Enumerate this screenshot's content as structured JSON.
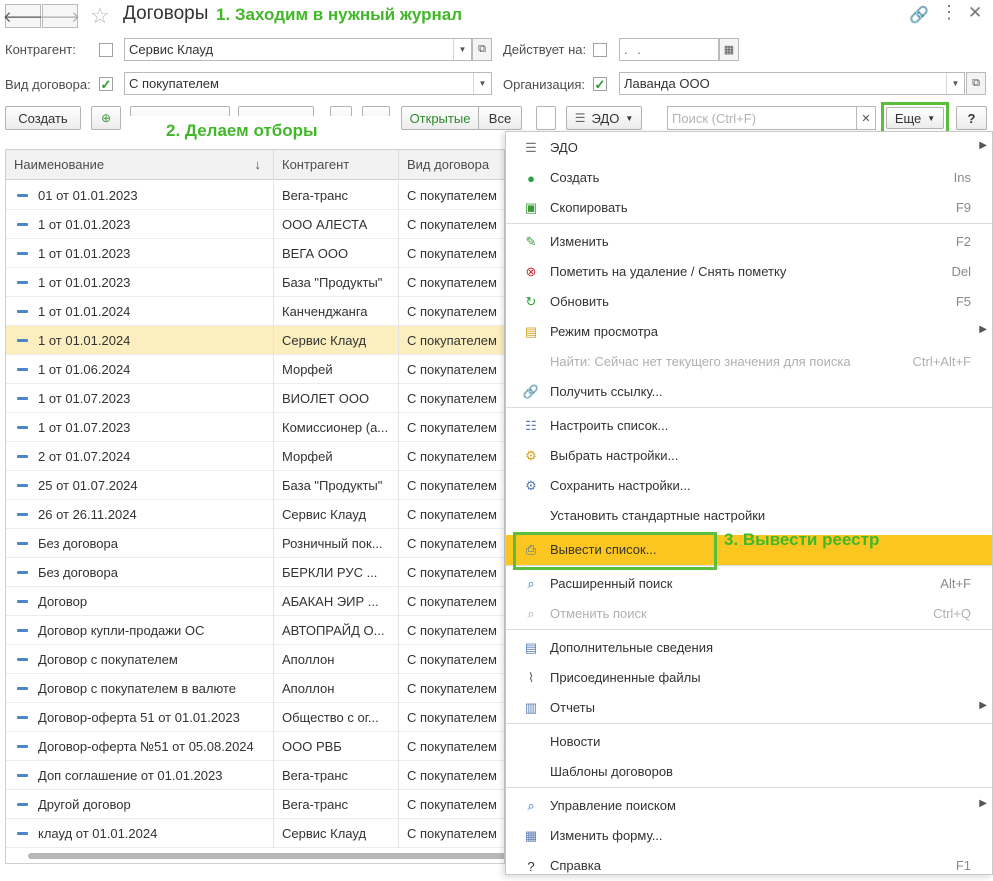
{
  "header": {
    "title": "Договоры",
    "annotation": "1. Заходим в нужный журнал"
  },
  "filters": {
    "counterparty_label": "Контрагент:",
    "counterparty_value": "Сервис Клауд",
    "valid_on_label": "Действует на:",
    "valid_on_value": " .  .",
    "contract_type_label": "Вид договора:",
    "contract_type_value": "С покупателем",
    "organization_label": "Организация:",
    "organization_value": "Лаванда ООО"
  },
  "toolbar": {
    "create_label": "Создать",
    "open_label": "Открытые",
    "all_label": "Все",
    "edo_label": "ЭДО",
    "search_placeholder": "Поиск (Ctrl+F)",
    "more_label": "Еще",
    "help_label": "?",
    "annotation": "2. Делаем отборы"
  },
  "table": {
    "columns": [
      "Наименование",
      "Контрагент",
      "Вид договора"
    ],
    "sort_indicator": "↓",
    "rows": [
      {
        "name": "01 от 01.01.2023",
        "counterparty": "Вега-транс",
        "type": "С покупателем"
      },
      {
        "name": "1 от 01.01.2023",
        "counterparty": "ООО АЛЕСТА",
        "type": "С покупателем"
      },
      {
        "name": "1 от 01.01.2023",
        "counterparty": "ВЕГА ООО",
        "type": "С покупателем"
      },
      {
        "name": "1 от 01.01.2023",
        "counterparty": "База \"Продукты\"",
        "type": "С покупателем"
      },
      {
        "name": "1 от 01.01.2024",
        "counterparty": "Канченджанга",
        "type": "С покупателем"
      },
      {
        "name": "1 от 01.01.2024",
        "counterparty": "Сервис Клауд",
        "type": "С покупателем"
      },
      {
        "name": "1 от 01.06.2024",
        "counterparty": "Морфей",
        "type": "С покупателем"
      },
      {
        "name": "1 от 01.07.2023",
        "counterparty": "ВИОЛЕТ ООО",
        "type": "С покупателем"
      },
      {
        "name": "1 от 01.07.2023",
        "counterparty": "Комиссионер (а...",
        "type": "С покупателем"
      },
      {
        "name": "2 от 01.07.2024",
        "counterparty": "Морфей",
        "type": "С покупателем"
      },
      {
        "name": "25 от 01.07.2024",
        "counterparty": "База \"Продукты\"",
        "type": "С покупателем"
      },
      {
        "name": "26 от 26.11.2024",
        "counterparty": "Сервис Клауд",
        "type": "С покупателем"
      },
      {
        "name": "Без договора",
        "counterparty": "Розничный пок...",
        "type": "С покупателем"
      },
      {
        "name": "Без договора",
        "counterparty": "БЕРКЛИ РУС ...",
        "type": "С покупателем"
      },
      {
        "name": "Договор",
        "counterparty": "АБАКАН ЭИР ...",
        "type": "С покупателем"
      },
      {
        "name": "Договор купли-продажи ОС",
        "counterparty": "АВТОПРАЙД О...",
        "type": "С покупателем"
      },
      {
        "name": "Договор с покупателем",
        "counterparty": "Аполлон",
        "type": "С покупателем"
      },
      {
        "name": "Договор с покупателем в валюте",
        "counterparty": "Аполлон",
        "type": "С покупателем"
      },
      {
        "name": "Договор-оферта 51 от 01.01.2023",
        "counterparty": "Общество с ог...",
        "type": "С покупателем"
      },
      {
        "name": "Договор-оферта №51 от 05.08.2024",
        "counterparty": "ООО РВБ",
        "type": "С покупателем"
      },
      {
        "name": "Доп соглашение от 01.01.2023",
        "counterparty": "Вега-транс",
        "type": "С покупателем"
      },
      {
        "name": "Другой договор",
        "counterparty": "Вега-транс",
        "type": "С покупателем"
      },
      {
        "name": "клауд от 01.01.2024",
        "counterparty": "Сервис Клауд",
        "type": "С покупателем"
      }
    ]
  },
  "menu": {
    "items": [
      {
        "label": "ЭДО",
        "shortcut": "",
        "arrow": "▶",
        "icon": "edo-icon"
      },
      {
        "label": "Создать",
        "shortcut": "Ins",
        "arrow": "",
        "icon": "plus-circle-icon"
      },
      {
        "label": "Скопировать",
        "shortcut": "F9",
        "arrow": "",
        "icon": "copy-icon"
      },
      {
        "label": "Изменить",
        "shortcut": "F2",
        "arrow": "",
        "icon": "pencil-icon"
      },
      {
        "label": "Пометить на удаление / Снять пометку",
        "shortcut": "Del",
        "arrow": "",
        "icon": "delete-mark-icon"
      },
      {
        "label": "Обновить",
        "shortcut": "F5",
        "arrow": "",
        "icon": "refresh-icon"
      },
      {
        "label": "Режим просмотра",
        "shortcut": "",
        "arrow": "▶",
        "icon": "view-mode-icon"
      },
      {
        "label": "Найти: Сейчас нет текущего значения для поиска",
        "shortcut": "Ctrl+Alt+F",
        "arrow": "",
        "icon": ""
      },
      {
        "label": "Получить ссылку...",
        "shortcut": "",
        "arrow": "",
        "icon": "link-icon"
      },
      {
        "label": "Настроить список...",
        "shortcut": "",
        "arrow": "",
        "icon": "list-settings-icon"
      },
      {
        "label": "Выбрать настройки...",
        "shortcut": "",
        "arrow": "",
        "icon": "choose-settings-icon"
      },
      {
        "label": "Сохранить настройки...",
        "shortcut": "",
        "arrow": "",
        "icon": "save-settings-icon"
      },
      {
        "label": "Установить стандартные настройки",
        "shortcut": "",
        "arrow": "",
        "icon": ""
      },
      {
        "label": "Вывести список...",
        "shortcut": "",
        "arrow": "",
        "icon": "print-list-icon"
      },
      {
        "label": "Расширенный поиск",
        "shortcut": "Alt+F",
        "arrow": "",
        "icon": "search-icon"
      },
      {
        "label": "Отменить поиск",
        "shortcut": "Ctrl+Q",
        "arrow": "",
        "icon": "cancel-search-icon"
      },
      {
        "label": "Дополнительные сведения",
        "shortcut": "",
        "arrow": "",
        "icon": "document-icon"
      },
      {
        "label": "Присоединенные файлы",
        "shortcut": "",
        "arrow": "",
        "icon": "paperclip-icon"
      },
      {
        "label": "Отчеты",
        "shortcut": "",
        "arrow": "▶",
        "icon": "reports-icon"
      },
      {
        "label": "Новости",
        "shortcut": "",
        "arrow": "",
        "icon": ""
      },
      {
        "label": "Шаблоны договоров",
        "shortcut": "",
        "arrow": "",
        "icon": ""
      },
      {
        "label": "Управление поиском",
        "shortcut": "",
        "arrow": "▶",
        "icon": "search-icon"
      },
      {
        "label": "Изменить форму...",
        "shortcut": "",
        "arrow": "",
        "icon": "form-icon"
      },
      {
        "label": "Справка",
        "shortcut": "F1",
        "arrow": "",
        "icon": "help-icon"
      }
    ],
    "annotation": "3. Вывести реестр"
  },
  "colors": {
    "annotation_green": "#42b72a",
    "highlight": "#fbc61f",
    "selected_row": "#fbeebf"
  }
}
